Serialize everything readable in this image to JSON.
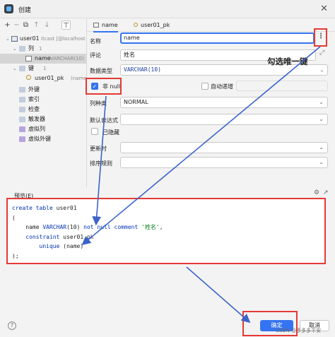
{
  "window": {
    "title": "创建",
    "close_glyph": "✕"
  },
  "toolbar": {
    "add": "+",
    "remove": "−",
    "copy": "⧉",
    "up": "↑",
    "down": "↓",
    "pin": "⊤"
  },
  "tree": {
    "table": {
      "name": "user01",
      "hint": "itcast [@localhost"
    },
    "columns_group": {
      "label": "列",
      "count": "1"
    },
    "column": {
      "name": "name",
      "hint": "VARCHAR(10)"
    },
    "keys_group": {
      "label": "键",
      "count": "1"
    },
    "key": {
      "name": "user01_pk",
      "hint": "(name)"
    },
    "folders": [
      "外键",
      "索引",
      "检查",
      "触发器",
      "虚拟列",
      "虚拟外键"
    ]
  },
  "tabs": [
    {
      "label": "name"
    },
    {
      "label": "user01_pk"
    }
  ],
  "form": {
    "name_label": "名称",
    "name_value": "name",
    "comment_label": "评论",
    "comment_value": "姓名",
    "datatype_label": "数据类型",
    "datatype_value": "VARCHAR(10)",
    "notnull_label": "非 null",
    "notnull_checked": true,
    "autoinc_label": "自动递增",
    "coltype_label": "列种类",
    "coltype_value": "NORMAL",
    "default_label": "默认表达式",
    "hidden_label": "已隐藏",
    "update_label": "更新时",
    "collation_label": "排序规则"
  },
  "annotation": "勾选唯一键",
  "preview": {
    "label": "预览(E)",
    "sql": [
      "create table user01",
      "(",
      "    name VARCHAR(10) not null comment '姓名',",
      "    constraint user01_pk",
      "        unique (name)",
      ");"
    ]
  },
  "footer": {
    "help": "?",
    "ok_label": "确定",
    "cancel_label": "取消",
    "watermark": "CSDN @多多多平安"
  },
  "colors": {
    "accent": "#3574f0",
    "annotation_red": "#e53935",
    "arrow_blue": "#3b63c9"
  }
}
